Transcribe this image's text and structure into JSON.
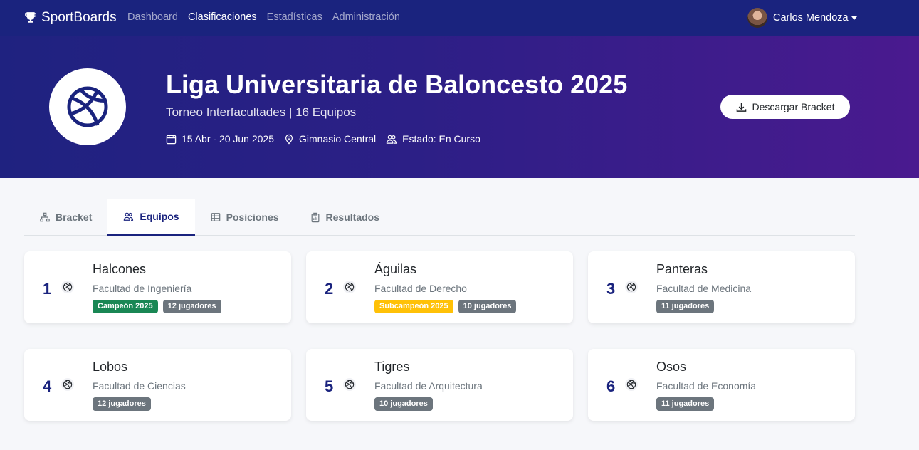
{
  "brand": {
    "name": "SportBoards"
  },
  "nav": {
    "links": [
      "Dashboard",
      "Clasificaciones",
      "Estadísticas",
      "Administración"
    ],
    "active": "Clasificaciones"
  },
  "user": {
    "name": "Carlos Mendoza"
  },
  "hero": {
    "title": "Liga Universitaria de Baloncesto 2025",
    "subtitle": "Torneo Interfacultades | 16 Equipos",
    "dates": "15 Abr - 20 Jun 2025",
    "venue": "Gimnasio Central",
    "status": "Estado: En Curso",
    "download_label": "Descargar Bracket"
  },
  "tabs": [
    "Bracket",
    "Equipos",
    "Posiciones",
    "Resultados"
  ],
  "active_tab": "Equipos",
  "colors": {
    "primary": "#1a237e",
    "champion": "#198754",
    "runner_up": "#ffc107",
    "players": "#6c757d"
  },
  "teams": [
    {
      "rank": "1",
      "name": "Halcones",
      "faculty": "Facultad de Ingeniería",
      "award": "Campeón 2025",
      "players": "12 jugadores"
    },
    {
      "rank": "2",
      "name": "Águilas",
      "faculty": "Facultad de Derecho",
      "award": "Subcampeón 2025",
      "players": "10 jugadores"
    },
    {
      "rank": "3",
      "name": "Panteras",
      "faculty": "Facultad de Medicina",
      "award": "",
      "players": "11 jugadores"
    },
    {
      "rank": "4",
      "name": "Lobos",
      "faculty": "Facultad de Ciencias",
      "award": "",
      "players": "12 jugadores"
    },
    {
      "rank": "5",
      "name": "Tigres",
      "faculty": "Facultad de Arquitectura",
      "award": "",
      "players": "10 jugadores"
    },
    {
      "rank": "6",
      "name": "Osos",
      "faculty": "Facultad de Economía",
      "award": "",
      "players": "11 jugadores"
    }
  ]
}
